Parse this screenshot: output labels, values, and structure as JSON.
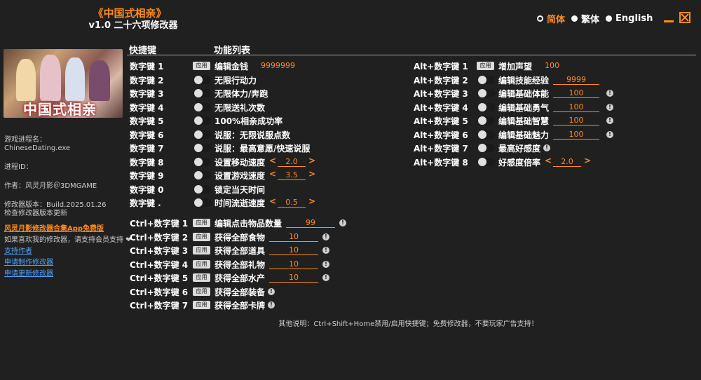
{
  "title": {
    "main": "《中国式相亲》",
    "sub": "v1.0 二十六项修改器"
  },
  "languages": [
    {
      "label": "简体",
      "active": true
    },
    {
      "label": "繁体",
      "active": false
    },
    {
      "label": "English",
      "active": false
    }
  ],
  "game_image": {
    "logo": "中国式相亲"
  },
  "sidebar": {
    "process_label": "游戏进程名：",
    "process_value": "ChineseDating.exe",
    "pid_label": "进程ID：",
    "author": "作者：风灵月影＠3DMGAME",
    "version": "修改器版本：Build.2025.01.26",
    "check_update": "检查修改器版本更新",
    "app_link": "风灵月影修改器合集App免费版",
    "support_text": "如果喜欢我的修改器，请支持会员支持 ❤",
    "support_link": "支持作者",
    "request_make": "申请制作修改器",
    "request_update": "申请更新修改器"
  },
  "headers": {
    "hotkey": "快捷键",
    "features": "功能列表"
  },
  "apply_label": "应用",
  "left_rows": [
    {
      "key": "数字键 1",
      "control": "apply",
      "feature": "编辑金钱",
      "value": "9999999",
      "value_style": "plain"
    },
    {
      "key": "数字键 2",
      "control": "toggle",
      "feature": "无限行动力"
    },
    {
      "key": "数字键 3",
      "control": "toggle",
      "feature": "无限体力/奔跑"
    },
    {
      "key": "数字键 4",
      "control": "toggle",
      "feature": "无限送礼次数"
    },
    {
      "key": "数字键 5",
      "control": "toggle",
      "feature": "100%相亲成功率"
    },
    {
      "key": "数字键 6",
      "control": "toggle",
      "feature": "说服：无限说服点数"
    },
    {
      "key": "数字键 7",
      "control": "toggle",
      "feature": "说服：最高意愿/快速说服"
    },
    {
      "key": "数字键 8",
      "control": "toggle",
      "feature": "设置移动速度",
      "value": "2.0",
      "value_style": "arrows"
    },
    {
      "key": "数字键 9",
      "control": "toggle",
      "feature": "设置游戏速度",
      "value": "3.5",
      "value_style": "arrows"
    },
    {
      "key": "数字键 0",
      "control": "toggle",
      "feature": "锁定当天时间"
    },
    {
      "key": "数字键 .",
      "control": "toggle",
      "feature": "时间流逝速度",
      "value": "0.5",
      "value_style": "arrows"
    },
    {
      "key": "Ctrl+数字键 1",
      "control": "apply",
      "feature": "编辑点击物品数量",
      "value": "99",
      "value_style": "input",
      "info": true
    },
    {
      "key": "Ctrl+数字键 2",
      "control": "apply",
      "feature": "获得全部食物",
      "value": "10",
      "value_style": "input",
      "info": true
    },
    {
      "key": "Ctrl+数字键 3",
      "control": "apply",
      "feature": "获得全部道具",
      "value": "10",
      "value_style": "input",
      "info": true
    },
    {
      "key": "Ctrl+数字键 4",
      "control": "apply",
      "feature": "获得全部礼物",
      "value": "10",
      "value_style": "input",
      "info": true
    },
    {
      "key": "Ctrl+数字键 5",
      "control": "apply",
      "feature": "获得全部水产",
      "value": "10",
      "value_style": "input",
      "info": true
    },
    {
      "key": "Ctrl+数字键 6",
      "control": "apply",
      "feature": "获得全部装备",
      "info": true
    },
    {
      "key": "Ctrl+数字键 7",
      "control": "apply",
      "feature": "获得全部卡牌",
      "info": true
    }
  ],
  "right_rows": [
    {
      "key": "Alt+数字键 1",
      "control": "apply",
      "feature": "增加声望",
      "value": "100",
      "value_style": "plain"
    },
    {
      "key": "Alt+数字键 2",
      "control": "toggle",
      "feature": "编辑技能经验",
      "value": "9999",
      "value_style": "input"
    },
    {
      "key": "Alt+数字键 3",
      "control": "toggle",
      "feature": "编辑基础体能",
      "value": "100",
      "value_style": "input",
      "info": true
    },
    {
      "key": "Alt+数字键 4",
      "control": "toggle",
      "feature": "编辑基础勇气",
      "value": "100",
      "value_style": "input",
      "info": true
    },
    {
      "key": "Alt+数字键 5",
      "control": "toggle",
      "feature": "编辑基础智慧",
      "value": "100",
      "value_style": "input",
      "info": true
    },
    {
      "key": "Alt+数字键 6",
      "control": "toggle",
      "feature": "编辑基础魅力",
      "value": "100",
      "value_style": "input",
      "info": true
    },
    {
      "key": "Alt+数字键 7",
      "control": "toggle",
      "feature": "最高好感度",
      "info": true
    },
    {
      "key": "Alt+数字键 8",
      "control": "toggle",
      "feature": "好感度倍率",
      "value": "2.0",
      "value_style": "arrows"
    }
  ],
  "footer": "其他说明：Ctrl+Shift+Home禁用/启用快捷键；免费修改器，不要玩家广告支持！",
  "icons": {
    "info": "info-icon",
    "minimize": "minimize-icon",
    "close": "close-icon"
  },
  "colors": {
    "accent": "#ff8c1a",
    "background": "#202020",
    "link": "#4da3ff"
  }
}
